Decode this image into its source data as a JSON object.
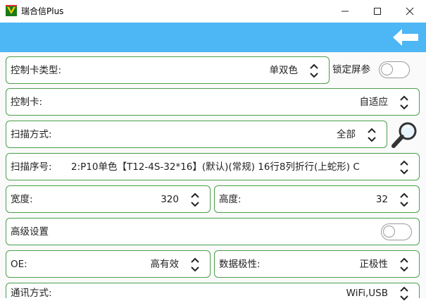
{
  "window": {
    "title": "瑞合信Plus",
    "minimize_icon": "minimize-icon",
    "maximize_icon": "maximize-icon",
    "close_icon": "close-icon"
  },
  "toolbar": {
    "back_icon": "back-arrow-icon",
    "color": "#4db6f4"
  },
  "form": {
    "card_type": {
      "label": "控制卡类型:",
      "value": "单双色"
    },
    "lock_screen": {
      "label": "锁定屏参",
      "on": false
    },
    "card": {
      "label": "控制卡:",
      "value": "自适应"
    },
    "scan_mode": {
      "label": "扫描方式:",
      "value": "全部"
    },
    "scan_order": {
      "label": "扫描序号:",
      "value": "2:P10单色【T12-4S-32*16】(默认)(常规) 16行8列折行(上蛇形) C"
    },
    "width": {
      "label": "宽度:",
      "value": "320"
    },
    "height": {
      "label": "高度:",
      "value": "32"
    },
    "advanced": {
      "label": "高级设置",
      "on": false
    },
    "oe": {
      "label": "OE:",
      "value": "高有效"
    },
    "data_polarity": {
      "label": "数据极性:",
      "value": "正极性"
    },
    "comm_mode": {
      "label": "通讯方式:",
      "value": "WiFi,USB"
    }
  },
  "colors": {
    "border": "#4aa04a",
    "accent": "#4db6f4"
  }
}
